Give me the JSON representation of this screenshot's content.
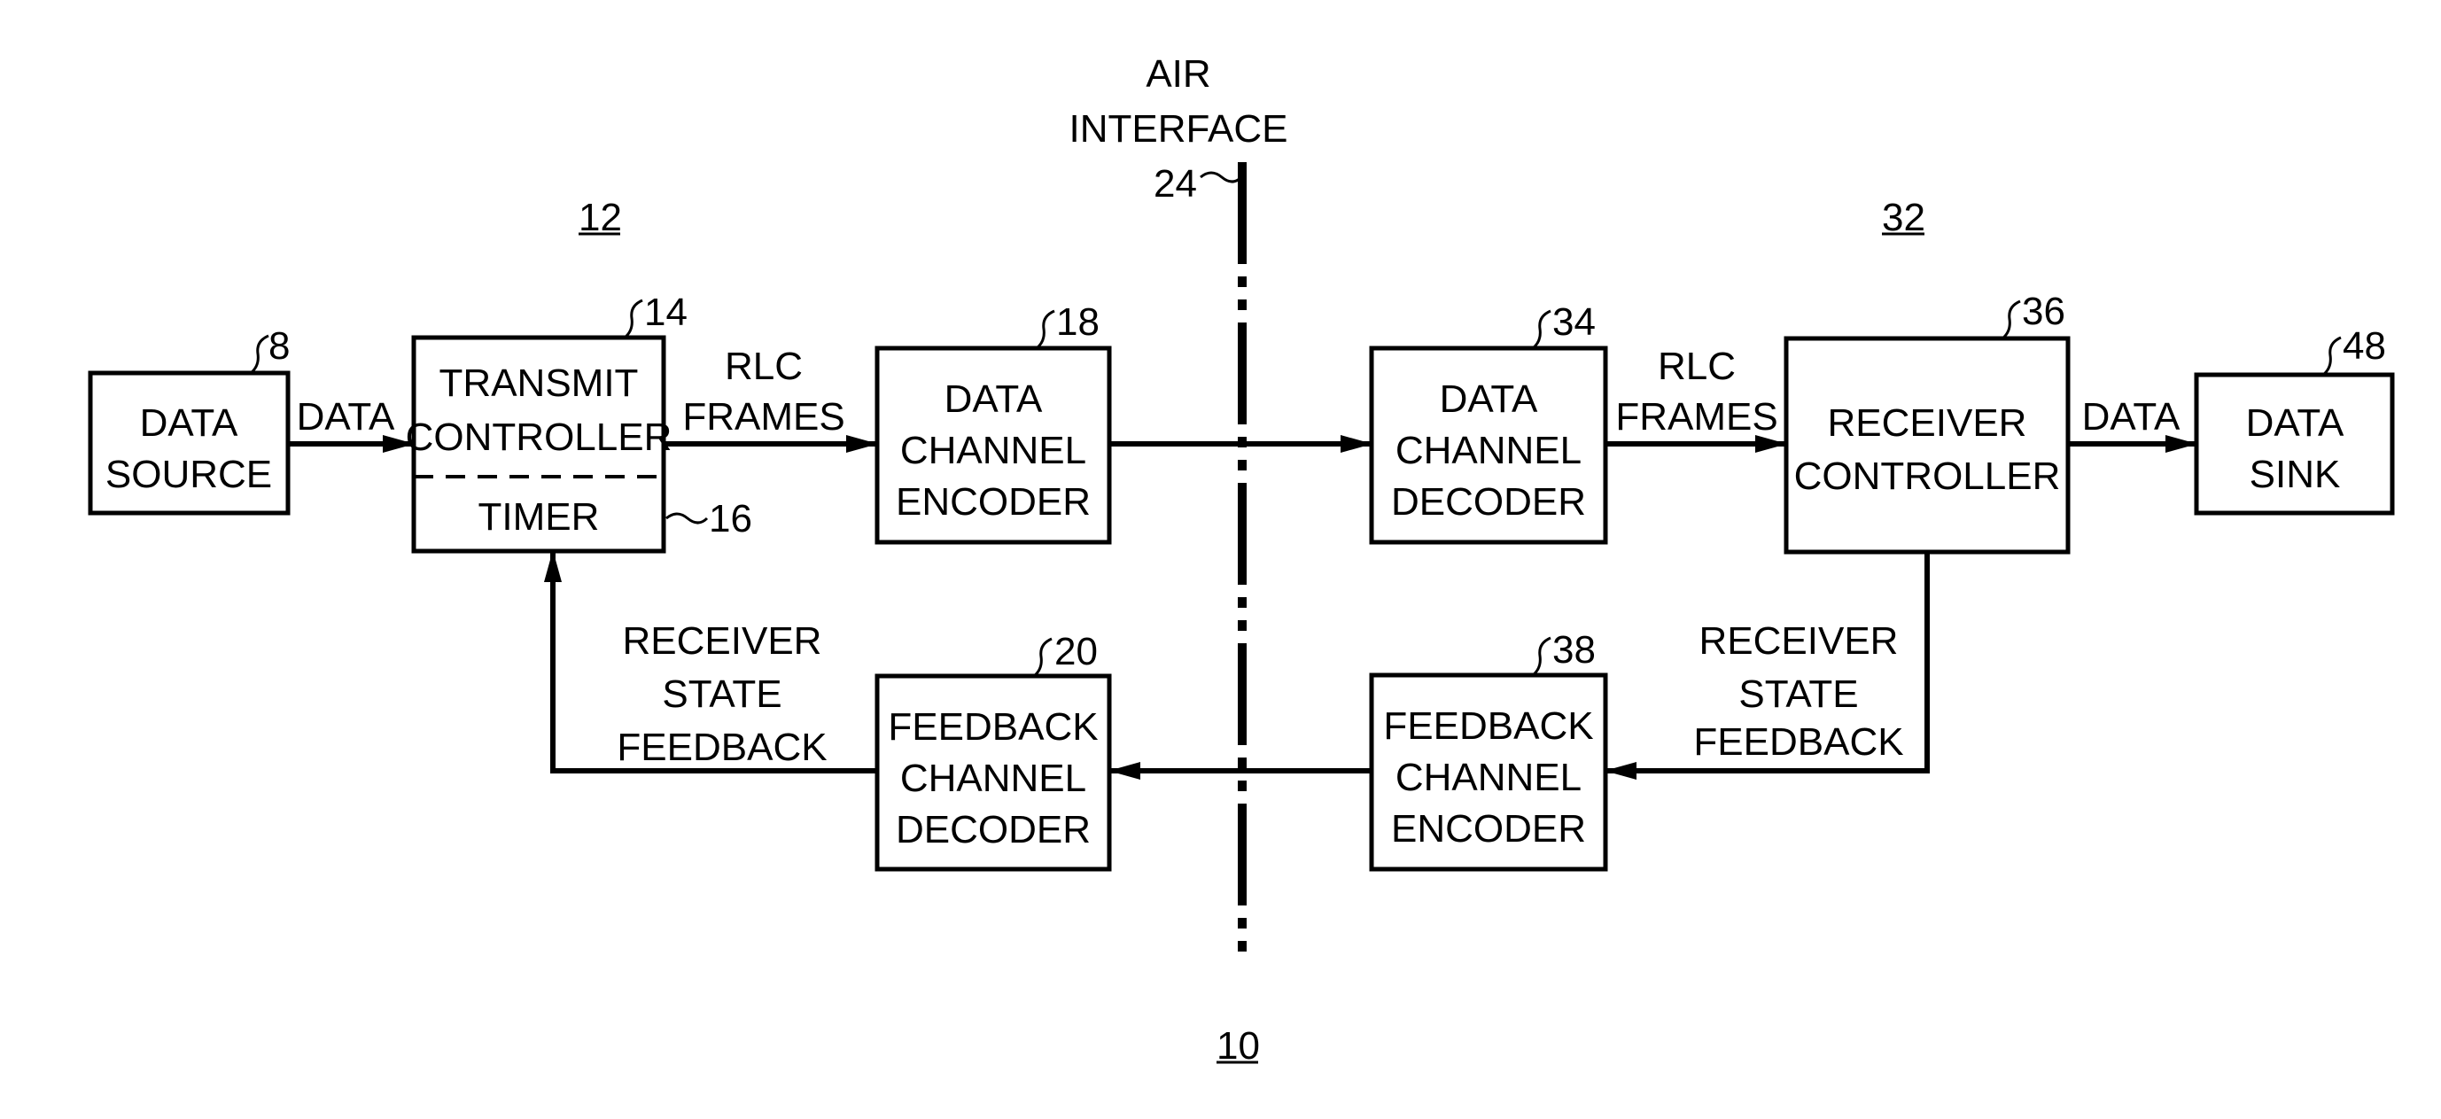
{
  "diagram": {
    "figure_ref": "10",
    "transmitter_ref": "12",
    "receiver_ref": "32",
    "air_interface": {
      "lines": [
        "AIR",
        "INTERFACE"
      ],
      "ref": "24"
    },
    "blocks": {
      "data_source": {
        "lines": [
          "DATA",
          "SOURCE"
        ],
        "ref": "8"
      },
      "transmit_controller": {
        "lines": [
          "TRANSMIT",
          "CONTROLLER"
        ],
        "ref": "14"
      },
      "timer": {
        "lines": [
          "TIMER"
        ],
        "ref": "16"
      },
      "data_channel_encoder": {
        "lines": [
          "DATA",
          "CHANNEL",
          "ENCODER"
        ],
        "ref": "18"
      },
      "feedback_channel_decoder": {
        "lines": [
          "FEEDBACK",
          "CHANNEL",
          "DECODER"
        ],
        "ref": "20"
      },
      "data_channel_decoder": {
        "lines": [
          "DATA",
          "CHANNEL",
          "DECODER"
        ],
        "ref": "34"
      },
      "receiver_controller": {
        "lines": [
          "RECEIVER",
          "CONTROLLER"
        ],
        "ref": "36"
      },
      "feedback_channel_encoder": {
        "lines": [
          "FEEDBACK",
          "CHANNEL",
          "ENCODER"
        ],
        "ref": "38"
      },
      "data_sink": {
        "lines": [
          "DATA",
          "SINK"
        ],
        "ref": "48"
      }
    },
    "edge_labels": {
      "data_in": [
        "DATA"
      ],
      "rlc_frames_tx": [
        "RLC",
        "FRAMES"
      ],
      "rlc_frames_rx": [
        "RLC",
        "FRAMES"
      ],
      "data_out": [
        "DATA"
      ],
      "feedback_tx": [
        "RECEIVER",
        "STATE",
        "FEEDBACK"
      ],
      "feedback_rx": [
        "RECEIVER",
        "STATE",
        "FEEDBACK"
      ]
    }
  }
}
